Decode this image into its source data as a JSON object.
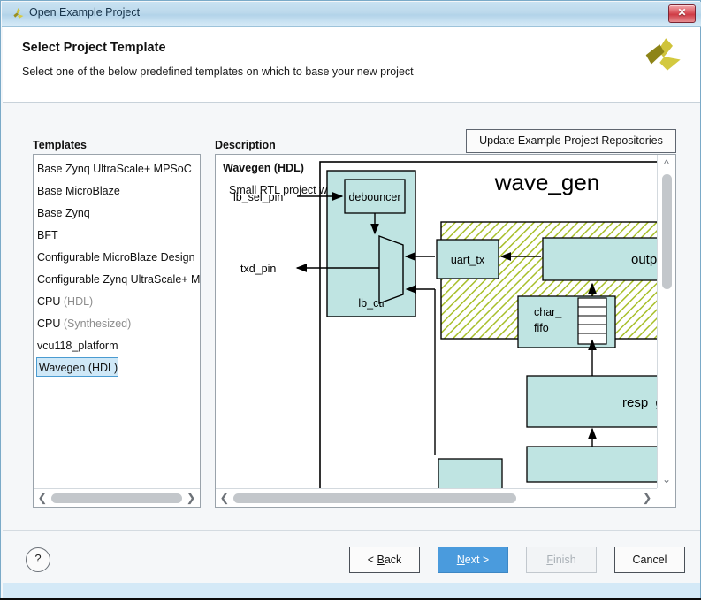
{
  "window": {
    "title": "Open Example Project",
    "close_label": "✕",
    "logo_icon": "xilinx-logo-icon"
  },
  "header": {
    "title": "Select Project Template",
    "subtitle": "Select one of the below predefined templates on which to base your new project",
    "logo_icon": "xilinx-logo-icon"
  },
  "templates_panel": {
    "label": "Templates",
    "items": [
      {
        "name": "Base Zynq UltraScale+ MPSoC",
        "qualifier": "",
        "selected": false
      },
      {
        "name": "Base MicroBlaze",
        "qualifier": "",
        "selected": false
      },
      {
        "name": "Base Zynq",
        "qualifier": "",
        "selected": false
      },
      {
        "name": "BFT",
        "qualifier": "",
        "selected": false
      },
      {
        "name": "Configurable MicroBlaze Design",
        "qualifier": "",
        "selected": false
      },
      {
        "name": "Configurable Zynq UltraScale+ MP",
        "qualifier": "",
        "selected": false
      },
      {
        "name": "CPU ",
        "qualifier": "(HDL)",
        "selected": false
      },
      {
        "name": "CPU ",
        "qualifier": "(Synthesized)",
        "selected": false
      },
      {
        "name": "vcu118_platform",
        "qualifier": "",
        "selected": false
      },
      {
        "name": "Wavegen (HDL)",
        "qualifier": "",
        "selected": true
      }
    ],
    "scroll_left_icon": "chevron-left-icon",
    "scroll_right_icon": "chevron-right-icon"
  },
  "description_panel": {
    "label": "Description",
    "update_button_label": "Update Example Project Repositories",
    "title": "Wavegen (HDL)",
    "text": "Small RTL project with IP",
    "scroll_up_icon": "chevron-up-icon",
    "scroll_down_icon": "chevron-down-icon",
    "scroll_left_icon": "chevron-left-icon",
    "scroll_right_icon": "chevron-right-icon"
  },
  "diagram": {
    "title": "wave_gen",
    "ports": [
      "lb_sel_pin",
      "txd_pin"
    ],
    "blocks": [
      {
        "label": "lb_ctl"
      },
      {
        "label": "debouncer"
      },
      {
        "label": "uart_tx"
      },
      {
        "label": "output_se"
      },
      {
        "label": "char_\nfifo"
      },
      {
        "label": "resp_ge"
      }
    ],
    "block_labels": {
      "lb_ctl": "lb_ctl",
      "debouncer": "debouncer",
      "uart_tx": "uart_tx",
      "output_sel": "output_se",
      "char_fifo_line1": "char_",
      "char_fifo_line2": "fifo",
      "resp_gen": "resp_ge"
    },
    "colors": {
      "block_fill": "#bfe4e2",
      "hatch_line": "#a8bf2a",
      "outline": "#000000"
    }
  },
  "footer": {
    "help_label": "?",
    "back": {
      "pre": "< ",
      "accel": "B",
      "post": "ack"
    },
    "next": {
      "pre": "",
      "accel": "N",
      "post": "ext >"
    },
    "finish": {
      "pre": "",
      "accel": "F",
      "post": "inish"
    },
    "cancel": {
      "pre": "",
      "accel": "",
      "post": "Cancel"
    }
  },
  "colors": {
    "accent": "#4a9bdd",
    "titlebar": "#bcd9ec",
    "close_red": "#cf3b45",
    "selection": "#cfe8f7",
    "selection_border": "#4a9bd1"
  }
}
